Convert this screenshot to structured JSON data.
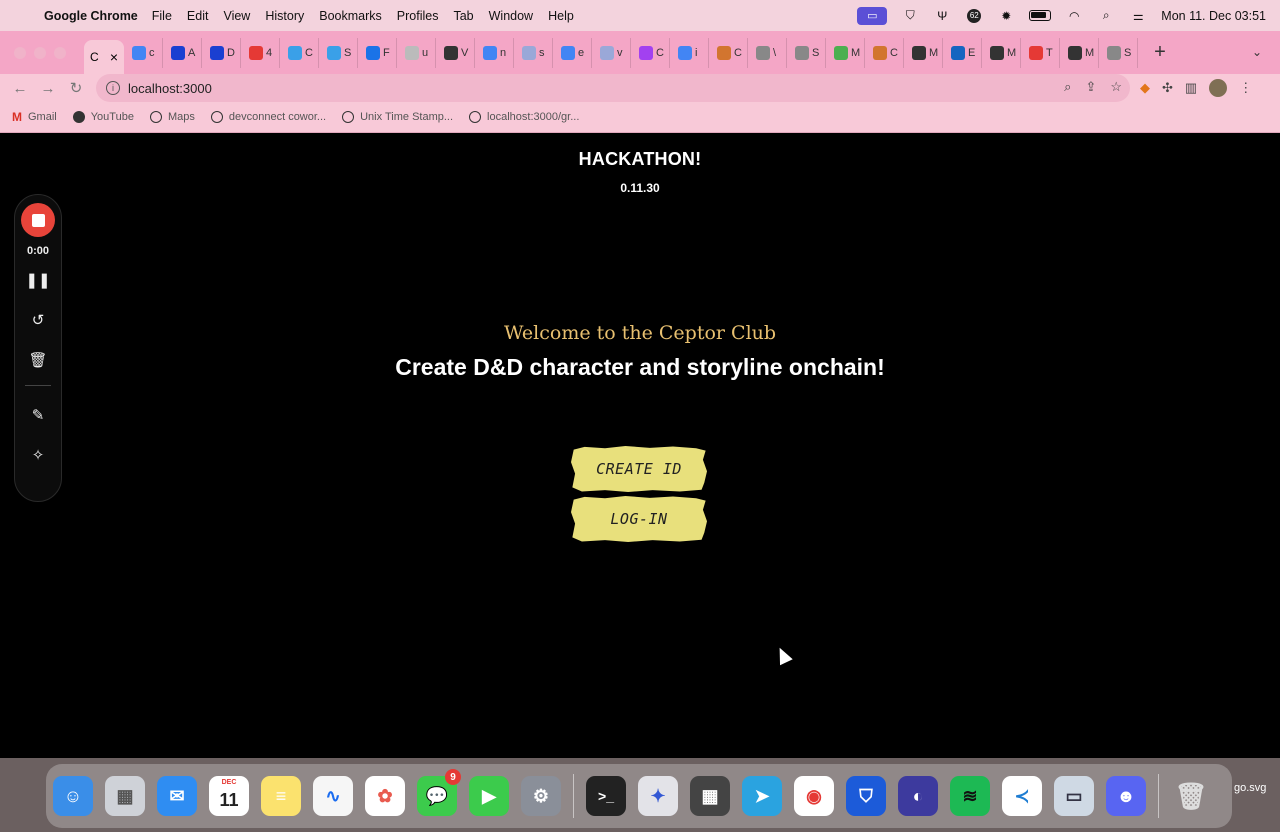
{
  "menubar": {
    "app_name": "Google Chrome",
    "items": [
      "File",
      "Edit",
      "View",
      "History",
      "Bookmarks",
      "Profiles",
      "Tab",
      "Window",
      "Help"
    ],
    "notification_count": "62",
    "datetime": "Mon 11. Dec  03:51"
  },
  "tabs": {
    "active_initial": "C",
    "items": [
      {
        "initial": "c",
        "color": "#4285f4"
      },
      {
        "initial": "A",
        "color": "#1a3fd1"
      },
      {
        "initial": "D",
        "color": "#1a3fd1"
      },
      {
        "initial": "4",
        "color": "#e53935"
      },
      {
        "initial": "C",
        "color": "#3aa0e8"
      },
      {
        "initial": "S",
        "color": "#3aa0e8"
      },
      {
        "initial": "F",
        "color": "#1a73e8"
      },
      {
        "initial": "u",
        "color": "#bbb"
      },
      {
        "initial": "V",
        "color": "#333"
      },
      {
        "initial": "n",
        "color": "#4285f4"
      },
      {
        "initial": "s",
        "color": "#9aa8d8"
      },
      {
        "initial": "e",
        "color": "#4285f4"
      },
      {
        "initial": "v",
        "color": "#9aa8d8"
      },
      {
        "initial": "C",
        "color": "#a241f0"
      },
      {
        "initial": "i",
        "color": "#4285f4"
      },
      {
        "initial": "C",
        "color": "#d2752f"
      },
      {
        "initial": "\\",
        "color": "#888"
      },
      {
        "initial": "S",
        "color": "#888"
      },
      {
        "initial": "M",
        "color": "#4caf50"
      },
      {
        "initial": "C",
        "color": "#d2752f"
      },
      {
        "initial": "M",
        "color": "#333"
      },
      {
        "initial": "E",
        "color": "#1565c0"
      },
      {
        "initial": "M",
        "color": "#333"
      },
      {
        "initial": "T",
        "color": "#e53935"
      },
      {
        "initial": "M",
        "color": "#333"
      },
      {
        "initial": "S",
        "color": "#888"
      }
    ]
  },
  "address_bar": {
    "url": "localhost:3000"
  },
  "bookmarks": [
    {
      "label": "Gmail",
      "icon": "gmail-icon"
    },
    {
      "label": "YouTube",
      "icon": "youtube-icon"
    },
    {
      "label": "Maps",
      "icon": "globe-icon"
    },
    {
      "label": "devconnect cowor...",
      "icon": "globe-icon"
    },
    {
      "label": "Unix Time Stamp...",
      "icon": "globe-icon"
    },
    {
      "label": "localhost:3000/gr...",
      "icon": "globe-icon"
    }
  ],
  "page": {
    "title": "HACKATHON!",
    "version": "0.11.30",
    "welcome": "Welcome to the Ceptor Club",
    "tagline": "Create D&D character and storyline onchain!",
    "create_button": "CREATE ID",
    "login_button": "LOG-IN",
    "accent_color": "#e8c070",
    "button_color": "#e8e07c"
  },
  "recorder": {
    "time": "0:00"
  },
  "dock": {
    "calendar_month": "DEC",
    "calendar_day": "11",
    "messages_badge": "9",
    "file_label": "go.svg"
  }
}
